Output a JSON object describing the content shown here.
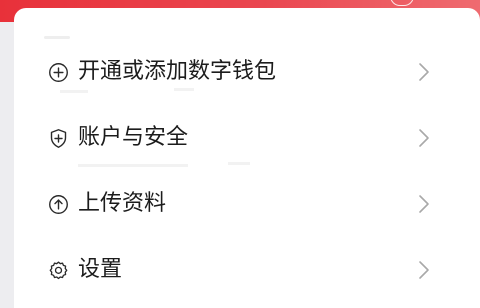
{
  "menu": {
    "items": [
      {
        "label": "开通或添加数字钱包",
        "icon": "plus-circle-icon"
      },
      {
        "label": "账户与安全",
        "icon": "shield-icon"
      },
      {
        "label": "上传资料",
        "icon": "upload-arrow-icon"
      },
      {
        "label": "设置",
        "icon": "gear-icon"
      }
    ],
    "chevron_icon": "chevron-right-icon"
  },
  "colors": {
    "banner_red": "#e8313a",
    "card_bg": "#ffffff",
    "page_bg": "#ededf0",
    "text": "#1c1c1c",
    "icon": "#2a2a2a",
    "chevron": "#a9a9a9"
  }
}
